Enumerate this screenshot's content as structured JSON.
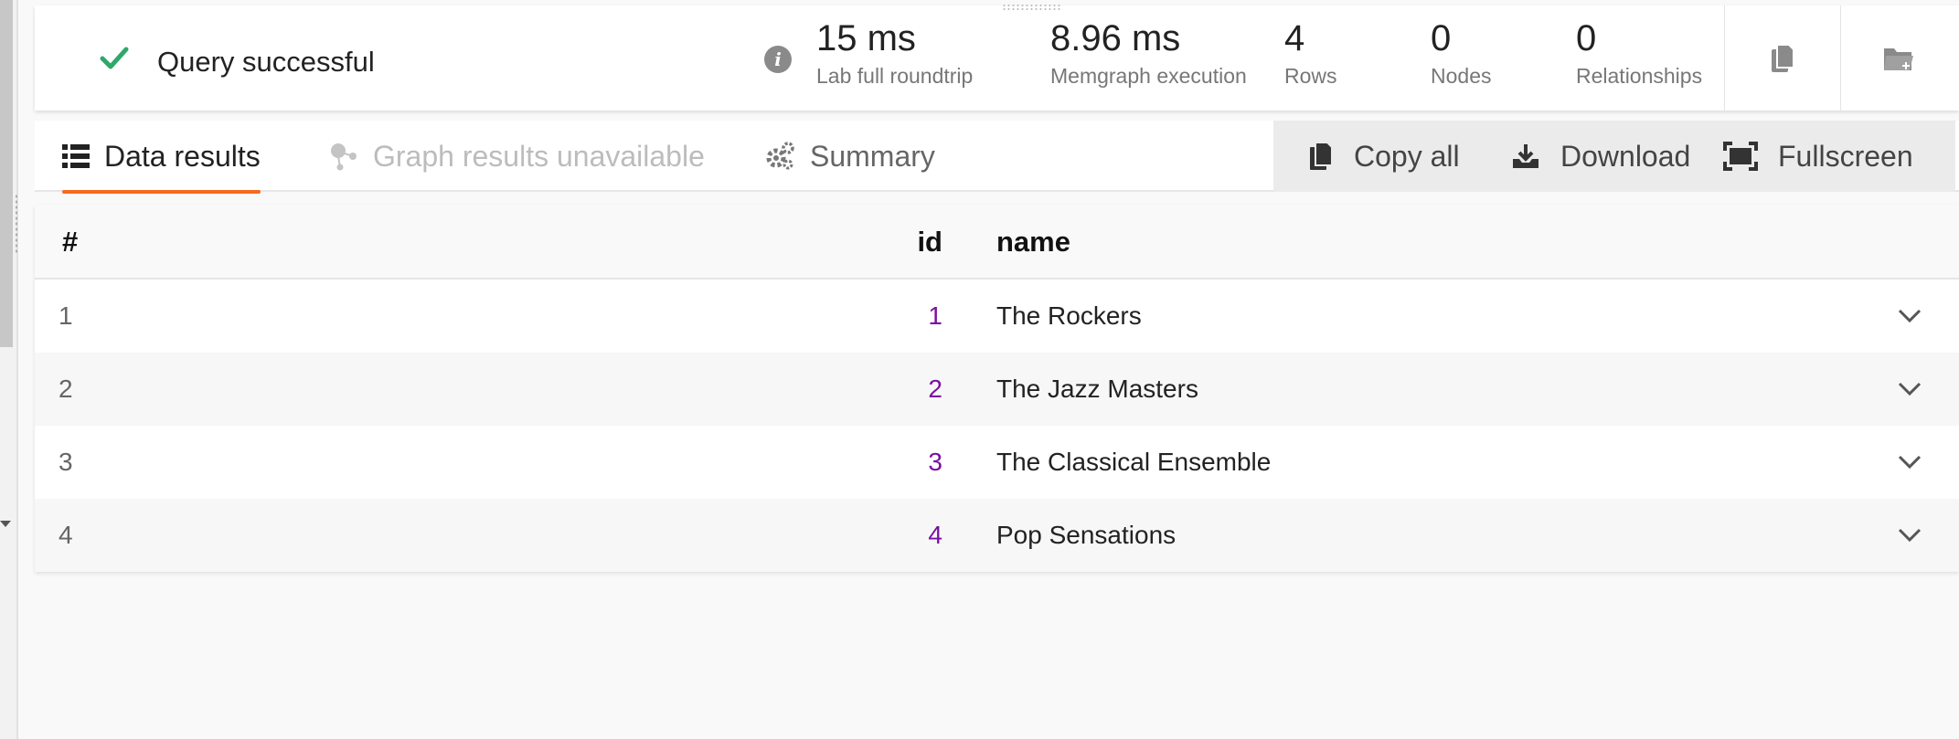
{
  "status": {
    "text": "Query successful",
    "color": "#2fa86a"
  },
  "stats": [
    {
      "value": "15 ms",
      "label": "Lab full roundtrip"
    },
    {
      "value": "8.96 ms",
      "label": "Memgraph execution"
    },
    {
      "value": "4",
      "label": "Rows"
    },
    {
      "value": "0",
      "label": "Nodes"
    },
    {
      "value": "0",
      "label": "Relationships"
    }
  ],
  "icons": {
    "info": "info-icon",
    "copy": "copy-icon",
    "folder": "folder-add-icon"
  },
  "tabs": [
    {
      "label": "Data results",
      "icon": "list-icon",
      "state": "active"
    },
    {
      "label": "Graph results unavailable",
      "icon": "graph-icon",
      "state": "disabled"
    },
    {
      "label": "Summary",
      "icon": "gears-icon",
      "state": "normal"
    }
  ],
  "actions": [
    {
      "label": "Copy all",
      "icon": "copy-icon"
    },
    {
      "label": "Download",
      "icon": "download-icon"
    },
    {
      "label": "Fullscreen",
      "icon": "fullscreen-icon"
    }
  ],
  "table": {
    "columns": [
      "#",
      "id",
      "name"
    ],
    "rows": [
      {
        "index": "1",
        "id": "1",
        "name": "The Rockers"
      },
      {
        "index": "2",
        "id": "2",
        "name": "The Jazz Masters"
      },
      {
        "index": "3",
        "id": "3",
        "name": "The Classical Ensemble"
      },
      {
        "index": "4",
        "id": "4",
        "name": "Pop Sensations"
      }
    ]
  },
  "colors": {
    "accent": "#f56a1e",
    "id_value": "#7b0fa3",
    "success": "#2fa86a"
  }
}
